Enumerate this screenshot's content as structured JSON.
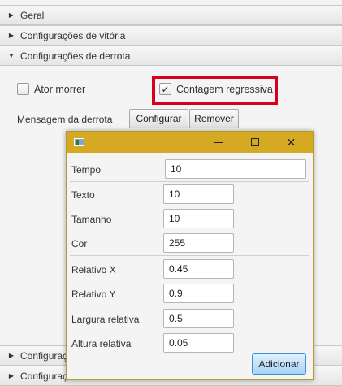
{
  "accordion": {
    "sections": [
      {
        "label": "Geral",
        "expanded": false
      },
      {
        "label": "Configurações de vitória",
        "expanded": false
      },
      {
        "label": "Configurações de derrota",
        "expanded": true
      },
      {
        "label": "Configurações de ...",
        "expanded": false
      },
      {
        "label": "Configurações de ...",
        "expanded": false
      }
    ]
  },
  "defeat": {
    "ator_morrer": {
      "label": "Ator morrer",
      "checked": false
    },
    "contagem_regressiva": {
      "label": "Contagem regressiva",
      "checked": true
    },
    "mensagem_label": "Mensagem da derrota",
    "configurar_label": "Configurar",
    "remover_label": "Remover"
  },
  "dialog": {
    "tempo": {
      "label": "Tempo",
      "value": "10"
    },
    "texto": {
      "label": "Texto",
      "value": "10"
    },
    "tamanho": {
      "label": "Tamanho",
      "value": "10"
    },
    "cor": {
      "label": "Cor",
      "value": "255"
    },
    "relativo_x": {
      "label": "Relativo X",
      "value": "0.45"
    },
    "relativo_y": {
      "label": "Relativo Y",
      "value": "0.9"
    },
    "largura_relativa": {
      "label": "Largura relativa",
      "value": "0.5"
    },
    "altura_relativa": {
      "label": "Altura relativa",
      "value": "0.05"
    },
    "adicionar_label": "Adicionar"
  },
  "colors": {
    "titlebar": "#d6a922",
    "highlight": "#d9001b",
    "default_button": "#a8d3f7"
  }
}
